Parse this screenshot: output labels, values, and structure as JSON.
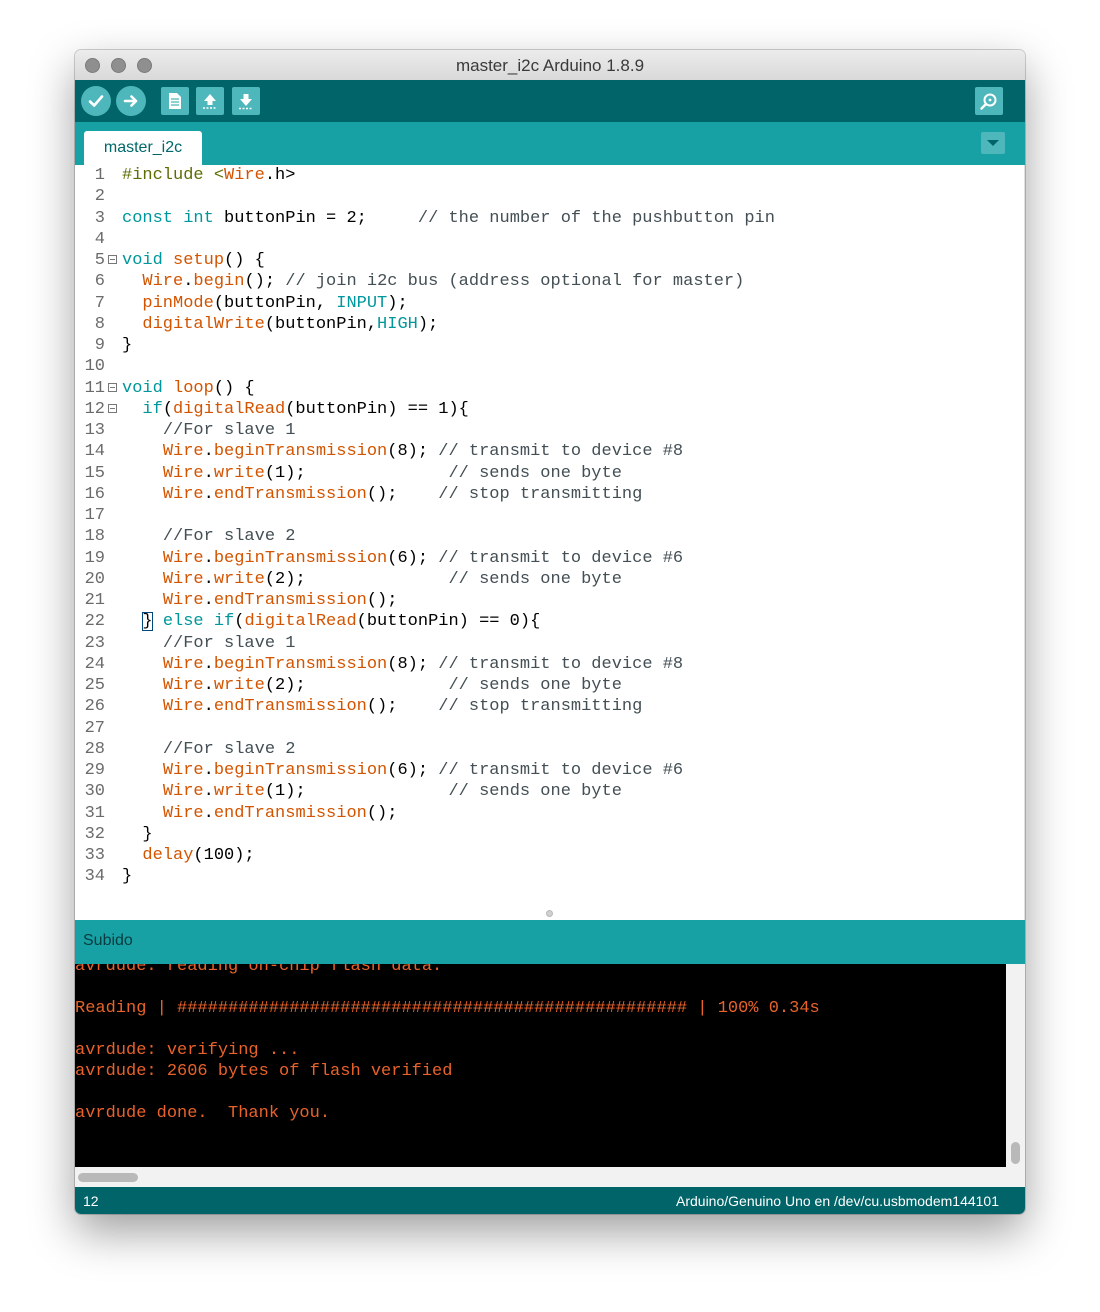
{
  "window": {
    "title": "master_i2c Arduino 1.8.9"
  },
  "toolbar": {
    "buttons": [
      {
        "name": "verify",
        "icon": "checkmark-icon"
      },
      {
        "name": "upload",
        "icon": "arrow-right-icon"
      },
      {
        "name": "new",
        "icon": "document-icon"
      },
      {
        "name": "open",
        "icon": "arrow-up-icon"
      },
      {
        "name": "save",
        "icon": "arrow-down-icon"
      },
      {
        "name": "serial-monitor",
        "icon": "magnifier-icon"
      }
    ]
  },
  "tabs": [
    {
      "label": "master_i2c",
      "active": true
    }
  ],
  "editor": {
    "lines": [
      {
        "n": "1"
      },
      {
        "n": "2"
      },
      {
        "n": "3"
      },
      {
        "n": "4"
      },
      {
        "n": "5"
      },
      {
        "n": "6"
      },
      {
        "n": "7"
      },
      {
        "n": "8"
      },
      {
        "n": "9"
      },
      {
        "n": "10"
      },
      {
        "n": "11"
      },
      {
        "n": "12"
      },
      {
        "n": "13"
      },
      {
        "n": "14"
      },
      {
        "n": "15"
      },
      {
        "n": "16"
      },
      {
        "n": "17"
      },
      {
        "n": "18"
      },
      {
        "n": "19"
      },
      {
        "n": "20"
      },
      {
        "n": "21"
      },
      {
        "n": "22"
      },
      {
        "n": "23"
      },
      {
        "n": "24"
      },
      {
        "n": "25"
      },
      {
        "n": "26"
      },
      {
        "n": "27"
      },
      {
        "n": "28"
      },
      {
        "n": "29"
      },
      {
        "n": "30"
      },
      {
        "n": "31"
      },
      {
        "n": "32"
      },
      {
        "n": "33"
      },
      {
        "n": "34"
      }
    ],
    "code": {
      "l1": [
        "#include <",
        "Wire",
        ".h>"
      ],
      "l3": [
        "const",
        " ",
        "int",
        " buttonPin = 2;     ",
        "// the number of the pushbutton pin"
      ],
      "l5": [
        "void",
        " ",
        "setup",
        "() {"
      ],
      "l6": [
        "  ",
        "Wire",
        ".",
        "begin",
        "(); ",
        "// join i2c bus (address optional for master)"
      ],
      "l7": [
        "  ",
        "pinMode",
        "(buttonPin, ",
        "INPUT",
        ");"
      ],
      "l8": [
        "  ",
        "digitalWrite",
        "(buttonPin,",
        "HIGH",
        ");"
      ],
      "l9": [
        "}"
      ],
      "l11": [
        "void",
        " ",
        "loop",
        "() {"
      ],
      "l12": [
        "  ",
        "if",
        "(",
        "digitalRead",
        "(buttonPin) == 1){"
      ],
      "l13": [
        "    ",
        "//For slave 1"
      ],
      "l14": [
        "    ",
        "Wire",
        ".",
        "beginTransmission",
        "(8); ",
        "// transmit to device #8"
      ],
      "l15": [
        "    ",
        "Wire",
        ".",
        "write",
        "(1);              ",
        "// sends one byte"
      ],
      "l16": [
        "    ",
        "Wire",
        ".",
        "endTransmission",
        "();    ",
        "// stop transmitting"
      ],
      "l18": [
        "    ",
        "//For slave 2"
      ],
      "l19": [
        "    ",
        "Wire",
        ".",
        "beginTransmission",
        "(6); ",
        "// transmit to device #6"
      ],
      "l20": [
        "    ",
        "Wire",
        ".",
        "write",
        "(2);              ",
        "// sends one byte"
      ],
      "l21": [
        "    ",
        "Wire",
        ".",
        "endTransmission",
        "();"
      ],
      "l22": [
        "  ",
        "}",
        " ",
        "else",
        " ",
        "if",
        "(",
        "digitalRead",
        "(buttonPin) == 0){"
      ],
      "l23": [
        "    ",
        "//For slave 1"
      ],
      "l24": [
        "    ",
        "Wire",
        ".",
        "beginTransmission",
        "(8); ",
        "// transmit to device #8"
      ],
      "l25": [
        "    ",
        "Wire",
        ".",
        "write",
        "(2);              ",
        "// sends one byte"
      ],
      "l26": [
        "    ",
        "Wire",
        ".",
        "endTransmission",
        "();    ",
        "// stop transmitting"
      ],
      "l28": [
        "    ",
        "//For slave 2"
      ],
      "l29": [
        "    ",
        "Wire",
        ".",
        "beginTransmission",
        "(6); ",
        "// transmit to device #6"
      ],
      "l30": [
        "    ",
        "Wire",
        ".",
        "write",
        "(1);              ",
        "// sends one byte"
      ],
      "l31": [
        "    ",
        "Wire",
        ".",
        "endTransmission",
        "();"
      ],
      "l32": [
        "  }"
      ],
      "l33": [
        "  ",
        "delay",
        "(100);"
      ],
      "l34": [
        "}"
      ]
    }
  },
  "status": {
    "message": "Subido"
  },
  "console": {
    "lines": [
      "avrdude: reading on-chip flash data:",
      "",
      "Reading | ################################################## | 100% 0.34s",
      "",
      "avrdude: verifying ...",
      "avrdude: 2606 bytes of flash verified",
      "",
      "avrdude done.  Thank you."
    ]
  },
  "footer": {
    "line": "12",
    "board": "Arduino/Genuino Uno en /dev/cu.usbmodem144101"
  },
  "colors": {
    "toolbar": "#006468",
    "tabbar": "#17a1a5",
    "keyword": "#00979c",
    "function": "#d35400",
    "console_text": "#e8622a"
  }
}
